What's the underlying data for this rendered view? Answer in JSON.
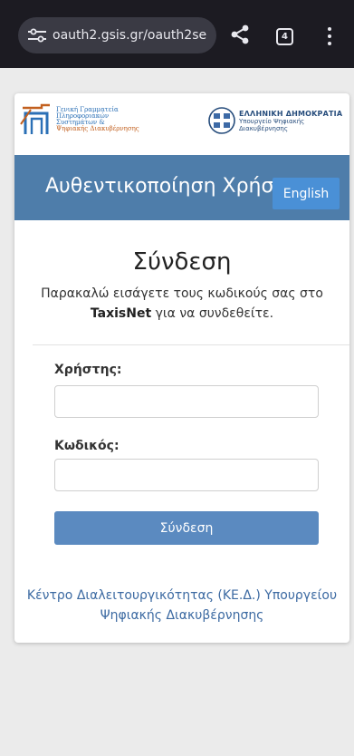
{
  "browser": {
    "url": "oauth2.gsis.gr/oauth2se",
    "tab_count": "4",
    "icons": {
      "site_settings": "tune-icon",
      "share": "share-icon",
      "tabs": "tab-switcher-icon",
      "menu": "more-vert-icon"
    }
  },
  "header": {
    "gsis_logo_lines": [
      "Γενική Γραμματεία",
      "Πληροφοριακών",
      "Συστημάτων &",
      "Ψηφιακής Διακυβέρνησης"
    ],
    "gov_logo_title": "ΕΛΛΗΝΙΚΗ ΔΗΜΟΚΡΑΤΙΑ",
    "gov_logo_sub_1": "Υπουργείο Ψηφιακής",
    "gov_logo_sub_2": "Διακυβέρνησης"
  },
  "banner": {
    "title": "Αυθεντικοποίηση Χρήστη",
    "language_button": "English"
  },
  "login": {
    "heading": "Σύνδεση",
    "intro_before": "Παρακαλώ εισάγετε τους κωδικούς σας στο",
    "intro_brand": "TaxisNet",
    "intro_after": "για να συνδεθείτε.",
    "username_label": "Χρήστης:",
    "username_value": "",
    "password_label": "Κωδικός:",
    "password_value": "",
    "submit_label": "Σύνδεση"
  },
  "footer": {
    "link_text": "Κέντρο Διαλειτουργικότητας (ΚΕ.Δ.) Υπουργείου Ψηφιακής Διακυβέρνησης"
  },
  "colors": {
    "banner": "#4e7daa",
    "language_button": "#4a90d6",
    "submit_button": "#5b8ac0",
    "link": "#3c6aa2",
    "browser_bar": "#1c1b22"
  }
}
